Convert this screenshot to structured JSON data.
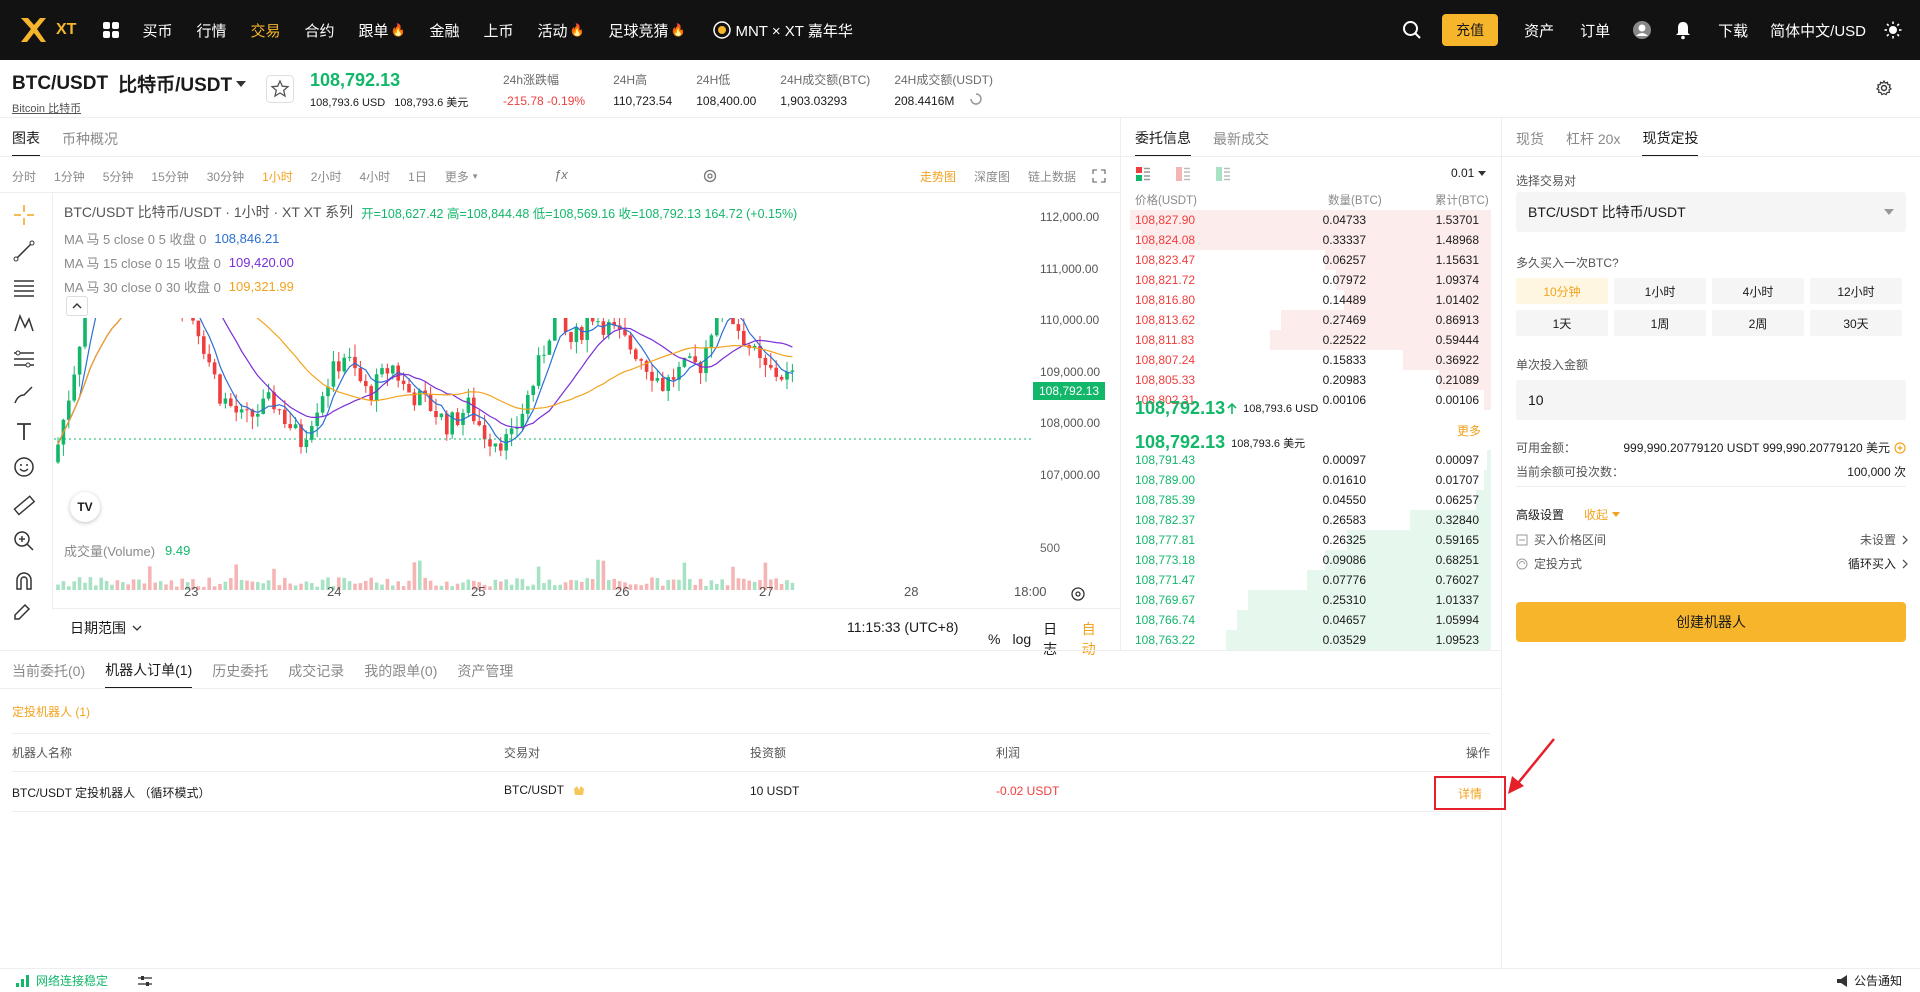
{
  "nav": {
    "logo_text": "XT",
    "items": [
      {
        "label": "买币",
        "active": false,
        "fire": false
      },
      {
        "label": "行情",
        "active": false,
        "fire": false
      },
      {
        "label": "交易",
        "active": true,
        "fire": false
      },
      {
        "label": "合约",
        "active": false,
        "fire": false
      },
      {
        "label": "跟单",
        "active": false,
        "fire": true
      },
      {
        "label": "金融",
        "active": false,
        "fire": false
      },
      {
        "label": "上币",
        "active": false,
        "fire": false
      },
      {
        "label": "活动",
        "active": false,
        "fire": true
      },
      {
        "label": "足球竞猜",
        "active": false,
        "fire": true
      }
    ],
    "promo": "MNT × XT 嘉年华",
    "deposit": "充值",
    "assets": "资产",
    "orders": "订单",
    "download": "下载",
    "language": "简体中文/USD"
  },
  "ticker": {
    "pair": "BTC/USDT",
    "pair_cn": "比特币/USDT",
    "sub_link": "Bitcoin  比特币",
    "last_price": "108,792.13",
    "last_usd": "108,793.6 USD",
    "last_cny": "108,793.6 美元",
    "stats": [
      {
        "label": "24h涨跌幅",
        "value": "-215.78  -0.19%",
        "color": "red"
      },
      {
        "label": "24H高",
        "value": "110,723.54",
        "color": ""
      },
      {
        "label": "24H低",
        "value": "108,400.00",
        "color": ""
      },
      {
        "label": "24H成交额(BTC)",
        "value": "1,903.03293",
        "color": ""
      },
      {
        "label": "24H成交额(USDT)",
        "value": "208.4416M",
        "color": ""
      }
    ]
  },
  "chart_panel": {
    "tabs": [
      "图表",
      "币种概况"
    ],
    "intervals": [
      "分时",
      "1分钟",
      "5分钟",
      "15分钟",
      "30分钟",
      "1小时",
      "2小时",
      "4小时",
      "1日",
      "更多"
    ],
    "active_interval": "1小时",
    "right_links": [
      "走势图",
      "深度图",
      "链上数据"
    ],
    "title_line": "BTC/USDT  比特币/USDT · 1小时 · XT  XT 系列",
    "ohlc": "开=108,627.42  高=108,844.48  低=108,569.16  收=108,792.13  164.72 (+0.15%)",
    "ma_lines": [
      {
        "label": "MA  马 5 close 0  5 收盘 0",
        "value": "108,846.21",
        "color": "#2a6fd6"
      },
      {
        "label": "MA  马 15 close 0  15 收盘 0",
        "value": "109,420.00",
        "color": "#7a2ed6"
      },
      {
        "label": "MA  马 30 close 0  30 收盘 0",
        "value": "109,321.99",
        "color": "#f2a31d"
      }
    ],
    "volume_label": "成交量(Volume)",
    "volume_value": "9.49",
    "volume_tick": "500",
    "price_ticks": [
      "112,000.00",
      "111,000.00",
      "110,000.00",
      "109,000.00",
      "108,000.00",
      "107,000.00"
    ],
    "current_price_tag": "108,792.13",
    "date_ticks": [
      "23",
      "24",
      "25",
      "26",
      "27",
      "28",
      "18:00"
    ],
    "date_range": "日期范围",
    "time": "11:15:33 (UTC+8)",
    "bottom_toggles": [
      "%",
      "log",
      "日志",
      "自动"
    ]
  },
  "orderbook": {
    "tabs": [
      "委托信息",
      "最新成交"
    ],
    "precision": "0.01",
    "headers": [
      "价格(USDT)",
      "数量(BTC)",
      "累计(BTC)"
    ],
    "asks": [
      [
        "108,827.90",
        "0.04733",
        "1.53701",
        0.98
      ],
      [
        "108,824.08",
        "0.33337",
        "1.48968",
        0.95
      ],
      [
        "108,823.47",
        "0.06257",
        "1.15631",
        0.45
      ],
      [
        "108,821.72",
        "0.07972",
        "1.09374",
        0.42
      ],
      [
        "108,816.80",
        "0.14489",
        "1.01402",
        0.4
      ],
      [
        "108,813.62",
        "0.27469",
        "0.86913",
        0.57
      ],
      [
        "108,811.83",
        "0.22522",
        "0.59444",
        0.6
      ],
      [
        "108,807.24",
        "0.15833",
        "0.36922",
        0.24
      ],
      [
        "108,805.33",
        "0.20983",
        "0.21089",
        0.14
      ],
      [
        "108,802.31",
        "0.00106",
        "0.00106",
        0.02
      ]
    ],
    "mid_price": "108,792.13",
    "mid_usd": "108,793.6 USD",
    "mid_price2": "108,792.13",
    "mid_usd2": "108,793.6 美元",
    "more": "更多",
    "bids": [
      [
        "108,791.43",
        "0.00097",
        "0.00097",
        0.01
      ],
      [
        "108,789.00",
        "0.01610",
        "0.01707",
        0.02
      ],
      [
        "108,785.39",
        "0.04550",
        "0.06257",
        0.04
      ],
      [
        "108,782.37",
        "0.26583",
        "0.32840",
        0.22
      ],
      [
        "108,777.81",
        "0.26325",
        "0.59165",
        0.39
      ],
      [
        "108,773.18",
        "0.09086",
        "0.68251",
        0.45
      ],
      [
        "108,771.47",
        "0.07776",
        "0.76027",
        0.5
      ],
      [
        "108,769.67",
        "0.25310",
        "1.01337",
        0.66
      ],
      [
        "108,766.74",
        "0.04657",
        "1.05994",
        0.69
      ],
      [
        "108,763.22",
        "0.03529",
        "1.09523",
        0.72
      ]
    ]
  },
  "bot_panel": {
    "tabs": [
      "现货",
      "杠杆 20x",
      "现货定投"
    ],
    "active_tab": "现货定投",
    "select_label": "选择交易对",
    "select_value": "BTC/USDT  比特币/USDT",
    "frequency_label": "多久买入一次BTC?",
    "periods": [
      "10分钟",
      "1小时",
      "4小时",
      "12小时",
      "1天",
      "1周",
      "2周",
      "30天"
    ],
    "active_period": "10分钟",
    "amount_label": "单次投入金额",
    "amount_value": "10",
    "available_label": "可用金额：",
    "available_value": "999,990.20779120 USDT  999,990.20779120 美元",
    "times_label": "当前余额可投次数：",
    "times_value": "100,000 次",
    "advanced_label": "高级设置",
    "collapse_label": "收起",
    "price_range_label": "买入价格区间",
    "price_range_value": "未设置",
    "mode_label": "定投方式",
    "mode_value": "循环买入",
    "create_button": "创建机器人"
  },
  "orders": {
    "tabs": [
      "当前委托(0)",
      "机器人订单(1)",
      "历史委托",
      "成交记录",
      "我的跟单(0)",
      "资产管理"
    ],
    "active_tab": "机器人订单(1)",
    "sub_label": "定投机器人 (1)",
    "headers": [
      "机器人名称",
      "交易对",
      "投资额",
      "利润",
      "操作"
    ],
    "rows": [
      {
        "name": "BTC/USDT 定投机器人 （循环模式）",
        "pair": "BTC/USDT",
        "amount": "10 USDT",
        "profit": "-0.02 USDT",
        "action": "详情"
      }
    ]
  },
  "footer": {
    "status": "网络连接稳定",
    "notice": "公告通知"
  }
}
